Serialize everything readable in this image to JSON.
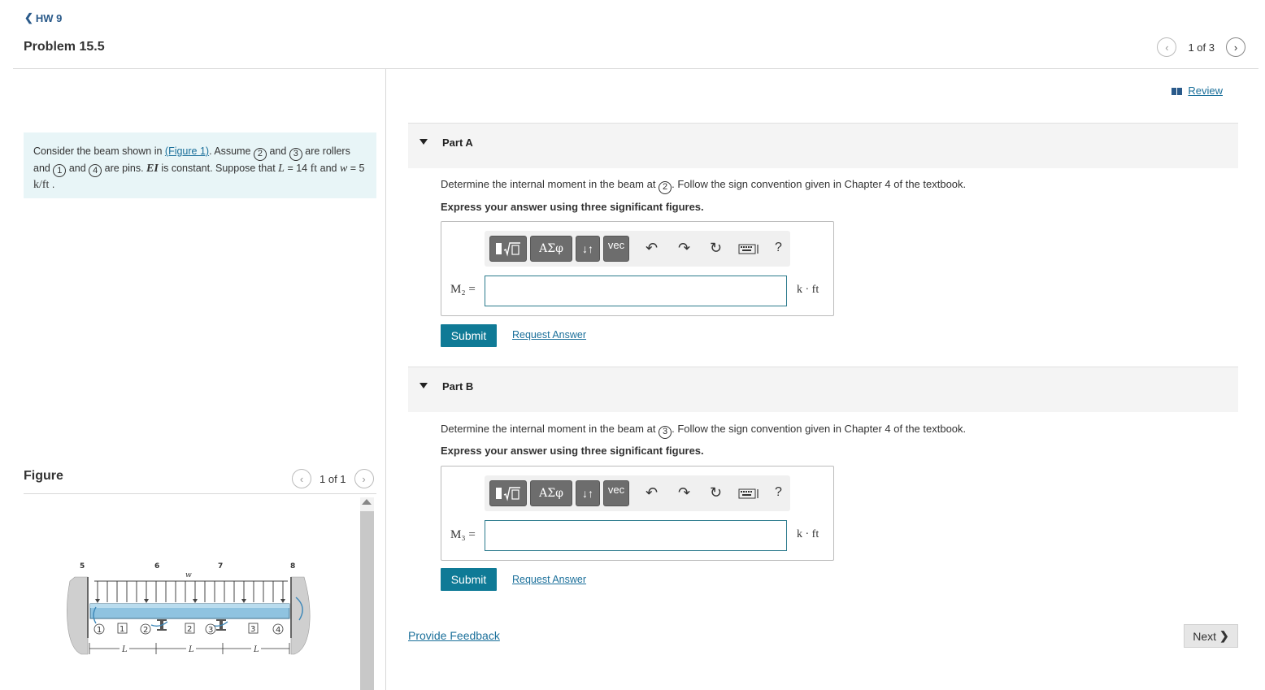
{
  "header": {
    "back_label": "HW 9",
    "problem_title": "Problem 15.5",
    "pager_text": "1 of 3"
  },
  "problem": {
    "segments": [
      "Consider the beam shown in ",
      "(Figure 1)",
      ". Assume ",
      "2",
      " and ",
      "3",
      " are rollers and ",
      "1",
      " and ",
      "4",
      " are pins. ",
      "EI",
      " is constant. Suppose that ",
      "L",
      " = 14 ",
      "ft",
      " and ",
      "w",
      " = 5 ",
      "k/ft",
      " ."
    ]
  },
  "figure": {
    "title": "Figure",
    "pager_text": "1 of 1",
    "labels": {
      "top_nums": [
        "5",
        "6",
        "7",
        "8"
      ],
      "load": "w",
      "supports": [
        "1",
        "2",
        "3",
        "4"
      ],
      "segments": [
        "1",
        "2",
        "3"
      ],
      "spans": [
        "L",
        "L",
        "L"
      ]
    }
  },
  "review_label": "Review",
  "parts": [
    {
      "title": "Part A",
      "question_pre": "Determine the internal moment in the beam at ",
      "question_point": "2",
      "question_post": ". Follow the sign convention given in Chapter 4 of the textbook.",
      "instruction": "Express your answer using three significant figures.",
      "var_label": "M₂ =",
      "input_value": "",
      "unit": "k · ft",
      "submit": "Submit",
      "request": "Request Answer"
    },
    {
      "title": "Part B",
      "question_pre": "Determine the internal moment in the beam at ",
      "question_point": "3",
      "question_post": ". Follow the sign convention given in Chapter 4 of the textbook.",
      "instruction": "Express your answer using three significant figures.",
      "var_label": "M₃ =",
      "input_value": "",
      "unit": "k · ft",
      "submit": "Submit",
      "request": "Request Answer"
    }
  ],
  "toolbar": {
    "templates_icon": "template-radical-icon",
    "greek": "ΑΣφ",
    "arrows": "↓↑",
    "vec": "vec",
    "undo_icon": "undo-icon",
    "redo_icon": "redo-icon",
    "reset_icon": "reset-icon",
    "keyboard_icon": "keyboard-icon",
    "help": "?"
  },
  "feedback_label": "Provide Feedback",
  "next_label": "Next"
}
